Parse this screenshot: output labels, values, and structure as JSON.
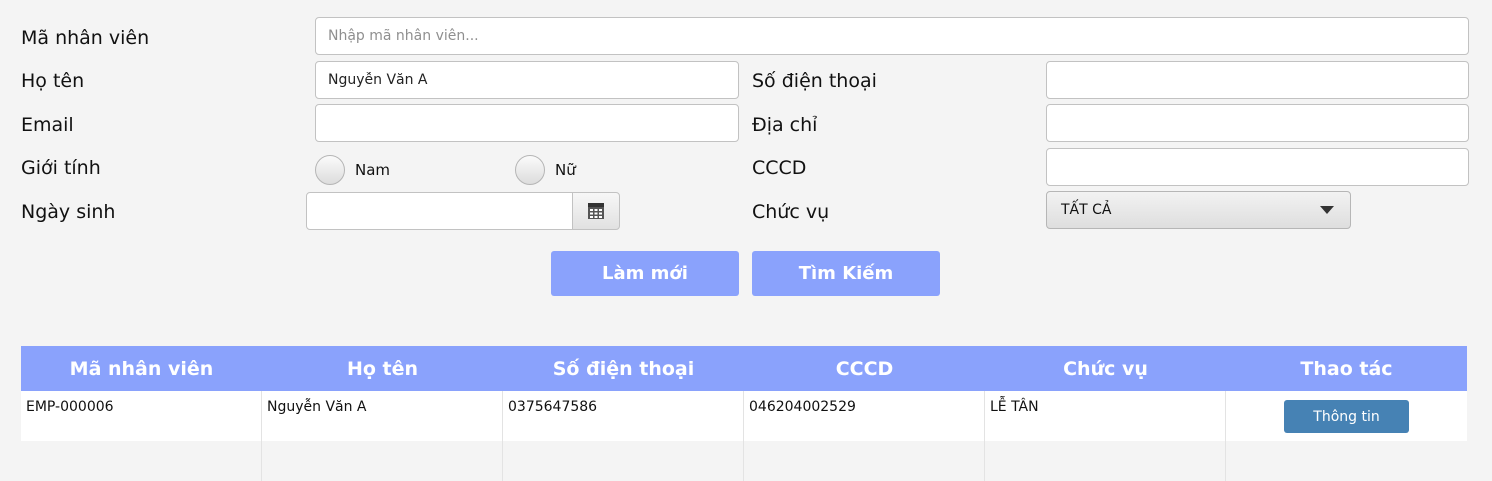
{
  "form": {
    "emp_id": {
      "label": "Mã nhân viên",
      "placeholder": "Nhập mã nhân viên...",
      "value": ""
    },
    "name": {
      "label": "Họ tên",
      "value": "Nguyễn Văn A"
    },
    "phone": {
      "label": "Số điện thoại",
      "value": ""
    },
    "email": {
      "label": "Email",
      "value": ""
    },
    "address": {
      "label": "Địa chỉ",
      "value": ""
    },
    "gender": {
      "label": "Giới tính",
      "options": [
        "Nam",
        "Nữ"
      ]
    },
    "cccd": {
      "label": "CCCD",
      "value": ""
    },
    "dob": {
      "label": "Ngày sinh",
      "value": ""
    },
    "role": {
      "label": "Chức vụ",
      "selected": "TẤT CẢ"
    }
  },
  "buttons": {
    "reset": "Làm mới",
    "search": "Tìm Kiếm"
  },
  "table": {
    "columns": [
      "Mã nhân viên",
      "Họ tên",
      "Số điện thoại",
      "CCCD",
      "Chức vụ",
      "Thao tác"
    ],
    "rows": [
      {
        "emp_id": "EMP-000006",
        "name": "Nguyễn Văn A",
        "phone": "0375647586",
        "cccd": "046204002529",
        "role": "LỄ TÂN",
        "action": "Thông tin"
      }
    ]
  },
  "colors": {
    "accent": "#8aa2fc",
    "row_button": "#4682b4",
    "background": "#f4f4f4"
  }
}
